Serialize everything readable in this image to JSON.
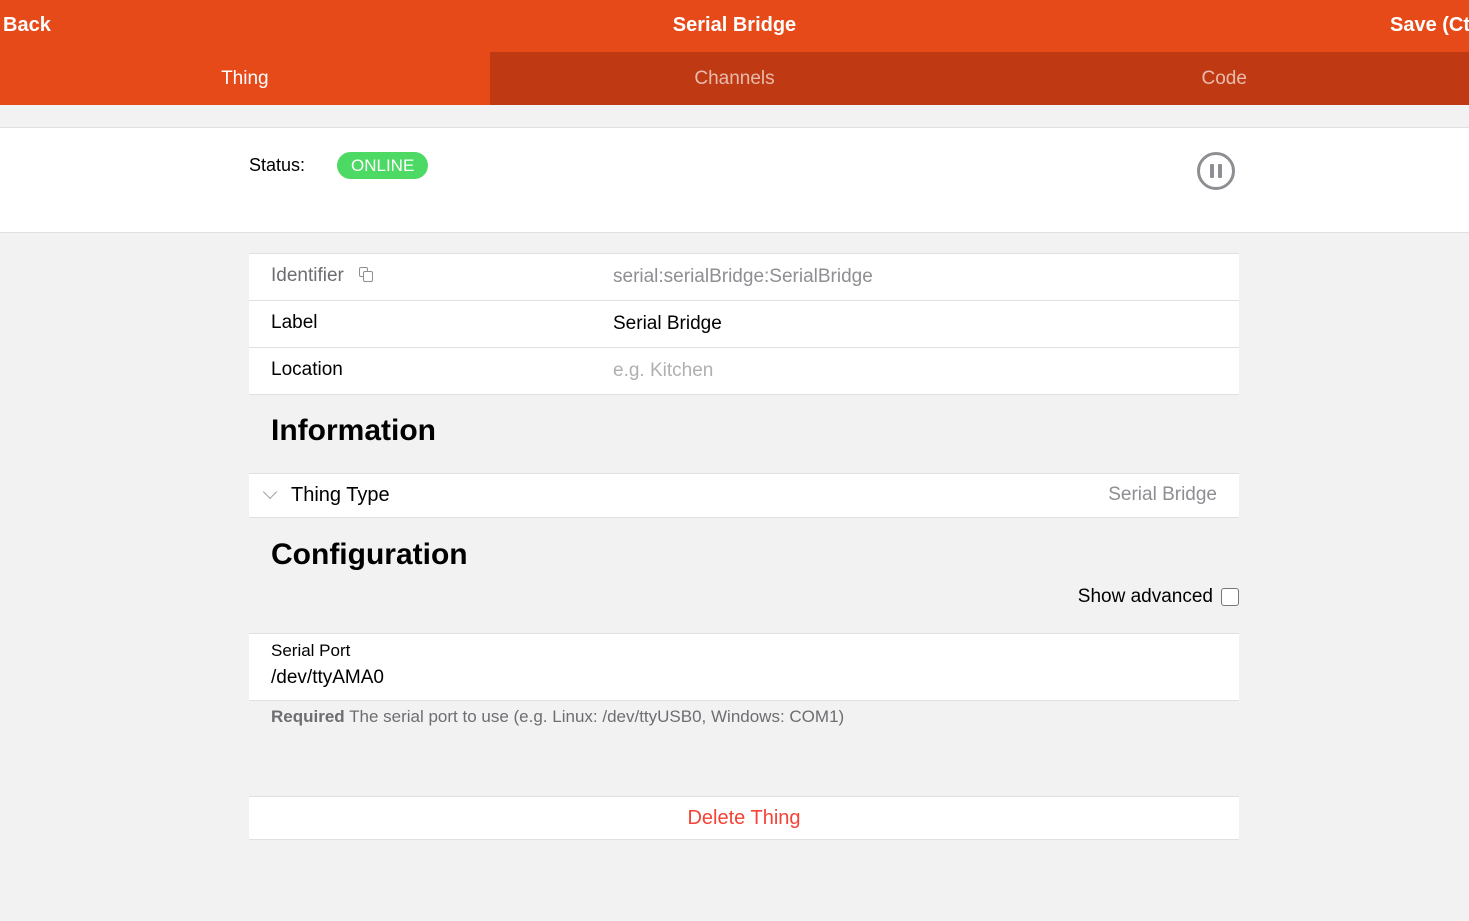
{
  "navbar": {
    "back_label": "Back",
    "title": "Serial Bridge",
    "save_label": "Save (Ctrl-S)"
  },
  "tabs": [
    {
      "label": "Thing",
      "active": true
    },
    {
      "label": "Channels",
      "active": false
    },
    {
      "label": "Code",
      "active": false
    }
  ],
  "status": {
    "label": "Status:",
    "value": "ONLINE",
    "color": "#4cd964",
    "action_icon": "pause-circle-icon"
  },
  "properties": {
    "identifier_label": "Identifier",
    "identifier_value": "serial:serialBridge:SerialBridge",
    "label_label": "Label",
    "label_value": "Serial Bridge",
    "location_label": "Location",
    "location_placeholder": "e.g. Kitchen"
  },
  "information": {
    "title": "Information",
    "thing_type_label": "Thing Type",
    "thing_type_value": "Serial Bridge"
  },
  "configuration": {
    "title": "Configuration",
    "show_advanced_label": "Show advanced",
    "show_advanced_checked": false,
    "serial_port_label": "Serial Port",
    "serial_port_value": "/dev/ttyAMA0",
    "hint_required": "Required",
    "hint_text": " The serial port to use (e.g. Linux: /dev/ttyUSB0, Windows: COM1)"
  },
  "actions": {
    "delete_label": "Delete Thing"
  },
  "colors": {
    "accent": "#e64a19",
    "tab_bar": "#bf3a13",
    "danger": "#f44336"
  }
}
